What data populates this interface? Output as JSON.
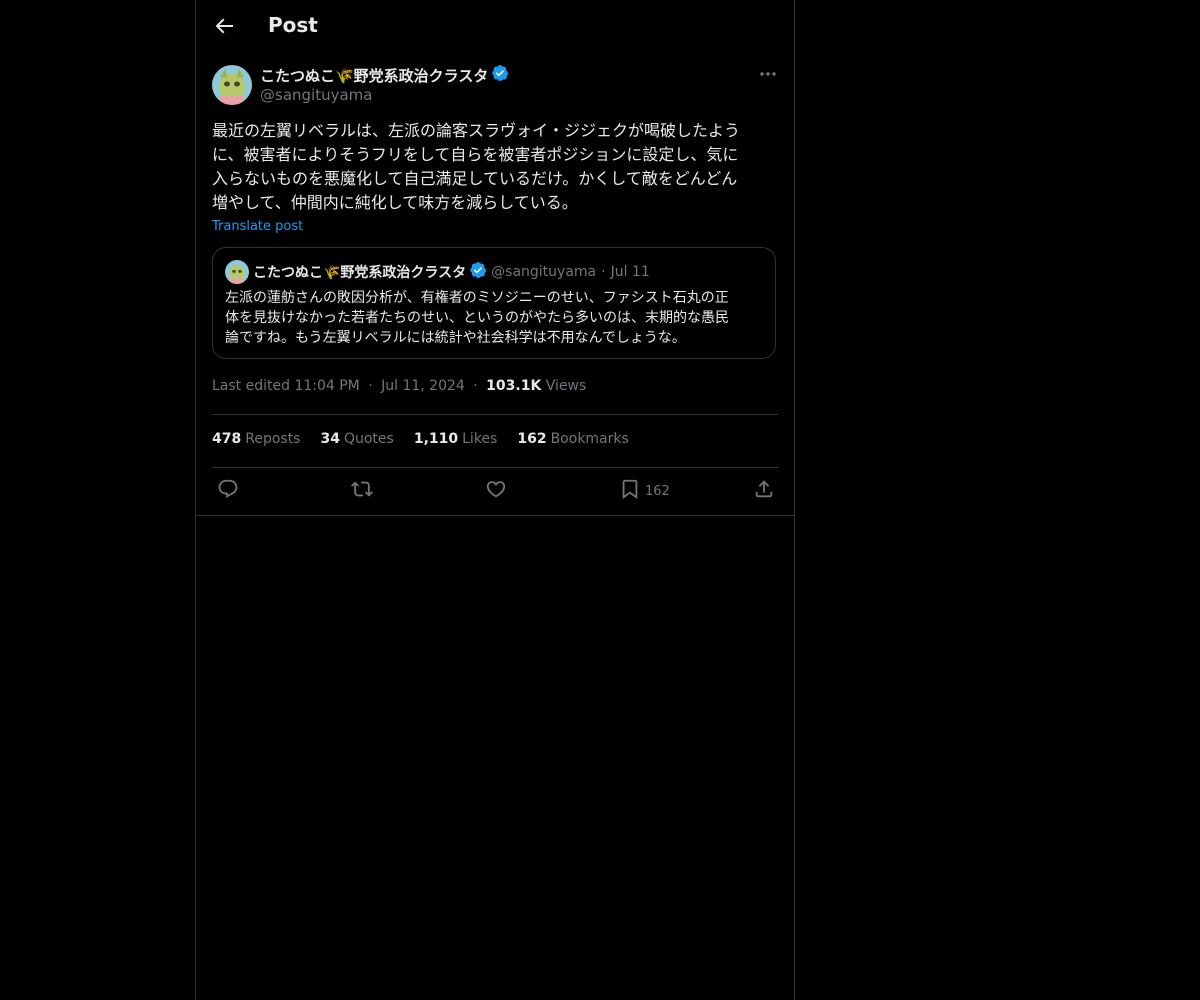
{
  "header": {
    "title": "Post"
  },
  "author": {
    "name": "こたつぬこ🌾野党系政治クラスタ",
    "handle": "@sangituyama"
  },
  "post": {
    "lines": [
      "最近の左翼リベラルは、左派の論客スラヴォイ・ジジェクが喝破したよう",
      "に、被害者によりそうフリをして自らを被害者ポジションに設定し、気に",
      "入らないものを悪魔化して自己満足しているだけ。かくして敵をどんどん",
      "増やして、仲間内に純化して味方を減らしている。"
    ],
    "translate_label": "Translate post"
  },
  "quote": {
    "name": "こたつぬこ🌾野党系政治クラスタ",
    "handle": "@sangituyama",
    "separator": "·",
    "date": "Jul 11",
    "lines": [
      "左派の蓮舫さんの敗因分析が、有権者のミソジニーのせい、ファシスト石丸の正",
      "体を見抜けなかった若者たちのせい、というのがやたら多いのは、末期的な愚民",
      "論ですね。もう左翼リベラルには統計や社会科学は不用なんでしょうな。"
    ]
  },
  "meta": {
    "edited": "Last edited 11:04 PM",
    "sep": "·",
    "date": "Jul 11, 2024",
    "views_count": "103.1K",
    "views_label": "Views"
  },
  "stats": [
    {
      "num": "478",
      "label": "Reposts"
    },
    {
      "num": "34",
      "label": "Quotes"
    },
    {
      "num": "1,110",
      "label": "Likes"
    },
    {
      "num": "162",
      "label": "Bookmarks"
    }
  ],
  "actions": {
    "bookmark_count": "162"
  },
  "icons": [
    "back-arrow-icon",
    "verified-badge-icon",
    "more-icon",
    "reply-icon",
    "repost-icon",
    "like-icon",
    "bookmark-icon",
    "share-icon"
  ],
  "colors": {
    "background": "#000000",
    "text": "#e7e9ea",
    "muted": "#71767b",
    "accent": "#1d9bf0",
    "border": "#2f3336"
  }
}
